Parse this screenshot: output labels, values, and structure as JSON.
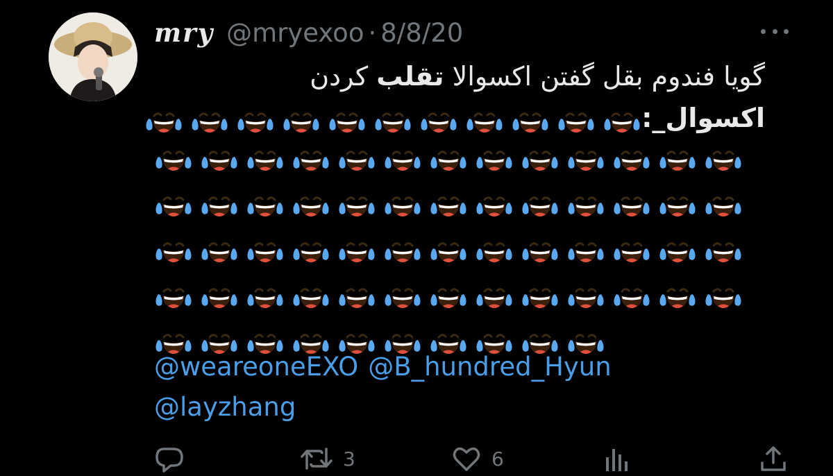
{
  "tweet": {
    "display_name": "mry",
    "handle": "@mryexoo",
    "separator": "·",
    "date": "8/8/20",
    "text_line1_start": "گویا فندوم بقل گفتن اکسوالا ",
    "text_line1_bold": "تقلب",
    "text_line1_end": " کردن",
    "text_line2_prefix": "اکسوال_:",
    "emoji_char": "😂",
    "emoji_rows": [
      11,
      13,
      13,
      13,
      13,
      10
    ],
    "mentions": [
      "@weareoneEXO",
      "@B_hundred_Hyun",
      "@layzhang"
    ]
  },
  "actions": {
    "reply_count": "",
    "retweet_count": "3",
    "like_count": "6"
  },
  "colors": {
    "background": "#000000",
    "text": "#e7e9ea",
    "muted": "#71767b",
    "link": "#4a9ee8"
  },
  "icons": [
    "more-icon",
    "reply-icon",
    "retweet-icon",
    "like-icon",
    "analytics-icon",
    "share-icon",
    "laughing-tears-emoji"
  ]
}
